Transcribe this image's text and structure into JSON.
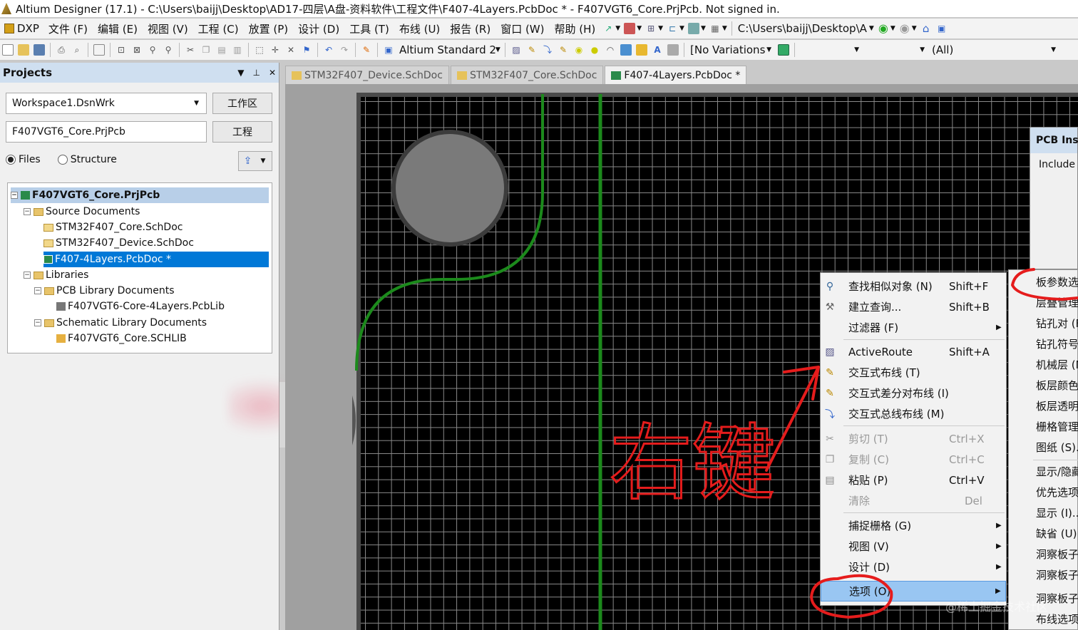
{
  "window": {
    "title": "Altium Designer (17.1) - C:\\Users\\baijj\\Desktop\\AD17-四层\\A盘-资料软件\\工程文件\\F407-4Layers.PcbDoc * - F407VGT6_Core.PrjPcb. Not signed in."
  },
  "menubar": {
    "dxp": "DXP",
    "items": [
      "文件 (F)",
      "编辑 (E)",
      "视图 (V)",
      "工程 (C)",
      "放置 (P)",
      "设计 (D)",
      "工具 (T)",
      "布线 (U)",
      "报告 (R)",
      "窗口 (W)",
      "帮助 (H)"
    ],
    "path": "C:\\Users\\baijj\\Desktop\\A"
  },
  "toolbar2": {
    "view_config": "Altium Standard 2",
    "variations": "[No Variations",
    "filter": "(All)"
  },
  "projects_panel": {
    "title": "Projects",
    "workspace": "Workspace1.DsnWrk",
    "workspace_btn": "工作区",
    "project": "F407VGT6_Core.PrjPcb",
    "project_btn": "工程",
    "radio_files": "Files",
    "radio_structure": "Structure",
    "tree": {
      "project": "F407VGT6_Core.PrjPcb",
      "source_docs": "Source Documents",
      "sch1": "STM32F407_Core.SchDoc",
      "sch2": "STM32F407_Device.SchDoc",
      "pcb": "F407-4Layers.PcbDoc *",
      "libraries": "Libraries",
      "pcblibs": "PCB Library Documents",
      "pcblib": "F407VGT6-Core-4Layers.PcbLib",
      "schlibs": "Schematic Library Documents",
      "schlib": "F407VGT6_Core.SCHLIB"
    }
  },
  "tabs": [
    "STM32F407_Device.SchDoc",
    "STM32F407_Core.SchDoc",
    "F407-4Layers.PcbDoc *"
  ],
  "inspector": {
    "title": "PCB Insp",
    "include": "Include"
  },
  "context_menu": {
    "items": [
      {
        "label": "查找相似对象 (N)",
        "shortcut": "Shift+F",
        "icon": "magnifier-icon"
      },
      {
        "label": "建立查询...",
        "shortcut": "Shift+B",
        "icon": "query-icon"
      },
      {
        "label": "过滤器 (F)",
        "shortcut": "",
        "icon": ""
      },
      {
        "label": "ActiveRoute",
        "shortcut": "Shift+A",
        "icon": "activeroute-icon"
      },
      {
        "label": "交互式布线 (T)",
        "shortcut": "",
        "icon": "route-icon"
      },
      {
        "label": "交互式差分对布线 (I)",
        "shortcut": "",
        "icon": "diffpair-icon"
      },
      {
        "label": "交互式总线布线 (M)",
        "shortcut": "",
        "icon": "bus-icon"
      },
      {
        "label": "剪切 (T)",
        "shortcut": "Ctrl+X",
        "icon": "cut-icon"
      },
      {
        "label": "复制 (C)",
        "shortcut": "Ctrl+C",
        "icon": "copy-icon"
      },
      {
        "label": "粘贴 (P)",
        "shortcut": "Ctrl+V",
        "icon": "paste-icon"
      },
      {
        "label": "清除",
        "shortcut": "Del",
        "icon": ""
      },
      {
        "label": "捕捉栅格 (G)",
        "shortcut": "",
        "icon": ""
      },
      {
        "label": "视图 (V)",
        "shortcut": "",
        "icon": ""
      },
      {
        "label": "设计 (D)",
        "shortcut": "",
        "icon": ""
      },
      {
        "label": "选项 (O)",
        "shortcut": "",
        "icon": ""
      }
    ]
  },
  "submenu": {
    "items": [
      "板参数选",
      "层叠管理",
      "钻孔对 (F",
      "钻孔符号",
      "机械层 (M",
      "板层颜色",
      "板层透明",
      "栅格管理",
      "图纸 (S)...",
      "显示/隐藏",
      "优先选项",
      "显示 (I)...",
      "缺省 (U)...",
      "洞察板子",
      "洞察板子",
      "洞察板子",
      "布线选项"
    ]
  },
  "annotation": {
    "handwriting": "右键"
  },
  "watermark": "@稀土掘金技术社区",
  "colors": {
    "track": "#1c8a1c",
    "annotation": "#e51c1c",
    "selection": "#0078d7"
  }
}
